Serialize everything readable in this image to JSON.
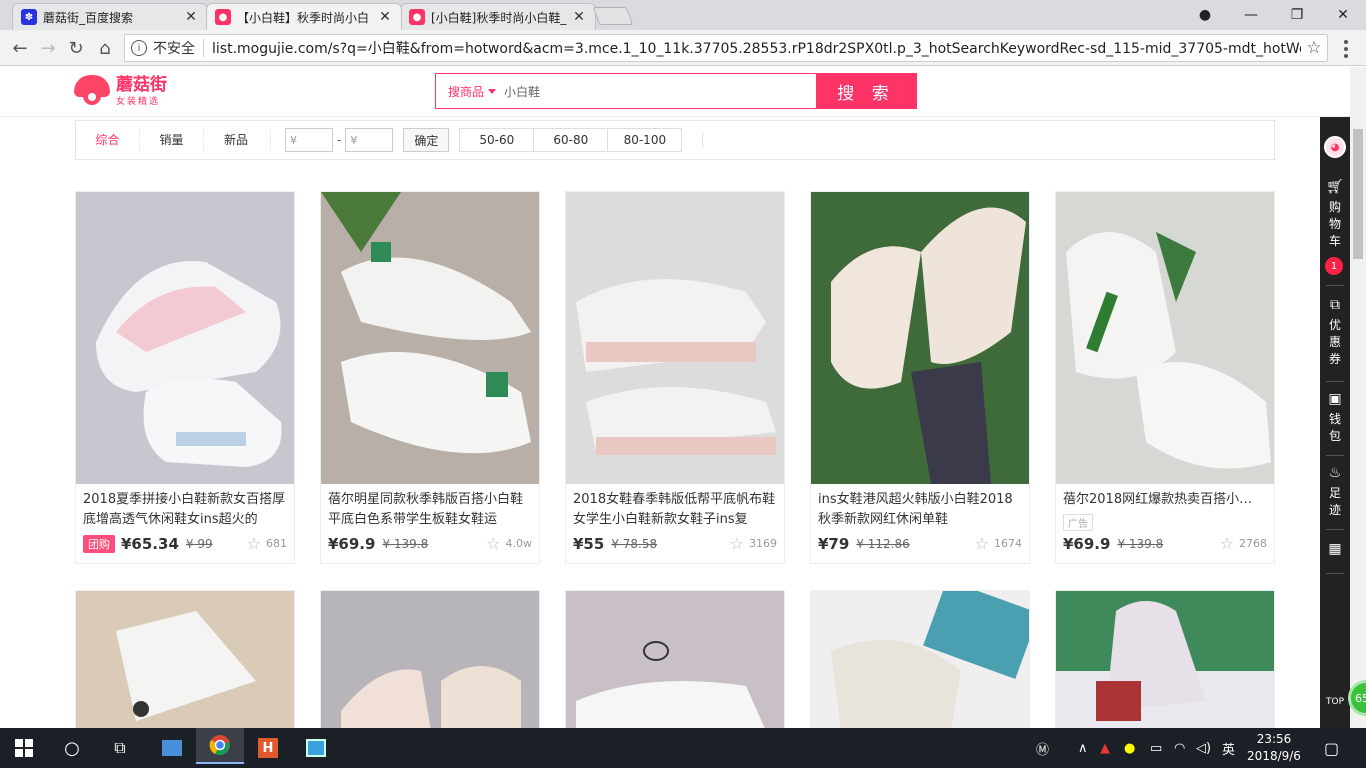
{
  "browser": {
    "tabs": [
      {
        "title": "蘑菇街_百度搜索",
        "favicon_color": "#2932e1",
        "active": false
      },
      {
        "title": "【小白鞋】秋季时尚小白",
        "favicon_color": "#ff3366",
        "active": true
      },
      {
        "title": "[小白鞋]秋季时尚小白鞋_",
        "favicon_color": "#ff3366",
        "active": false
      }
    ],
    "insecure_label": "不安全",
    "url": "list.mogujie.com/s?q=小白鞋&from=hotword&acm=3.mce.1_10_11k.37705.28553.rP18dr2SPX0tl.p_3_hotSearchKeywordRec-sd_115-mid_37705-mdt_hotWord-..."
  },
  "header": {
    "brand": "蘑菇街",
    "slogan": "女装精选",
    "search_scope": "搜商品",
    "search_value": "小白鞋",
    "search_button": "搜 索"
  },
  "filter": {
    "sorts": [
      "综合",
      "销量",
      "新品"
    ],
    "price_placeholder": "¥",
    "dash": "-",
    "confirm": "确定",
    "ranges": [
      "50-60",
      "60-80",
      "80-100"
    ]
  },
  "products": [
    {
      "title": "2018夏季拼接小白鞋新款女百搭厚底增高透气休闲鞋女ins超火的",
      "tag": "团购",
      "price": "¥65.34",
      "orig": "¥ 99",
      "favs": "681",
      "bg": "#c9c6cf",
      "accent": "#f3c9d2"
    },
    {
      "title": "蓓尔明星同款秋季韩版百搭小白鞋平底白色系带学生板鞋女鞋运",
      "tag": "",
      "price": "¥69.9",
      "orig": "¥ 139.8",
      "favs": "4.0w",
      "bg": "#b8b0a8",
      "accent": "#2e8b57"
    },
    {
      "title": "2018女鞋春季韩版低帮平底帆布鞋女学生小白鞋新款女鞋子ins复",
      "tag": "",
      "price": "¥55",
      "orig": "¥ 78.58",
      "favs": "3169",
      "bg": "#dcdcdc",
      "accent": "#e8c8c0"
    },
    {
      "title": "ins女鞋港风超火韩版小白鞋2018秋季新款网红休闲单鞋",
      "tag": "",
      "price": "¥79",
      "orig": "¥ 112.86",
      "favs": "1674",
      "bg": "#3f6b3a",
      "accent": "#f1e6dc"
    },
    {
      "title": "蓓尔2018网红爆款热卖百搭小…",
      "tag": "",
      "ad": "广告",
      "price": "¥69.9",
      "orig": "¥ 139.8",
      "favs": "2768",
      "bg": "#d6d8d4",
      "accent": "#2e7d32"
    }
  ],
  "row2": [
    {
      "bg": "#d9cbb8",
      "accent": "#f4f4f2"
    },
    {
      "bg": "#b7b5b9",
      "accent": "#f0e0d8"
    },
    {
      "bg": "#c8c0c6",
      "accent": "#f6f6f6"
    },
    {
      "bg": "#efefef",
      "accent": "#4aa0b0"
    },
    {
      "bg": "#3f8a5a",
      "accent": "#e8e0e8"
    }
  ],
  "sidebar": {
    "cart": "购物车",
    "cart_count": "1",
    "coupon": "优惠券",
    "wallet": "钱包",
    "footprint": "足迹",
    "top": "TOP",
    "float_number": "65"
  },
  "taskbar": {
    "time": "23:56",
    "date": "2018/9/6",
    "ime": "英"
  }
}
